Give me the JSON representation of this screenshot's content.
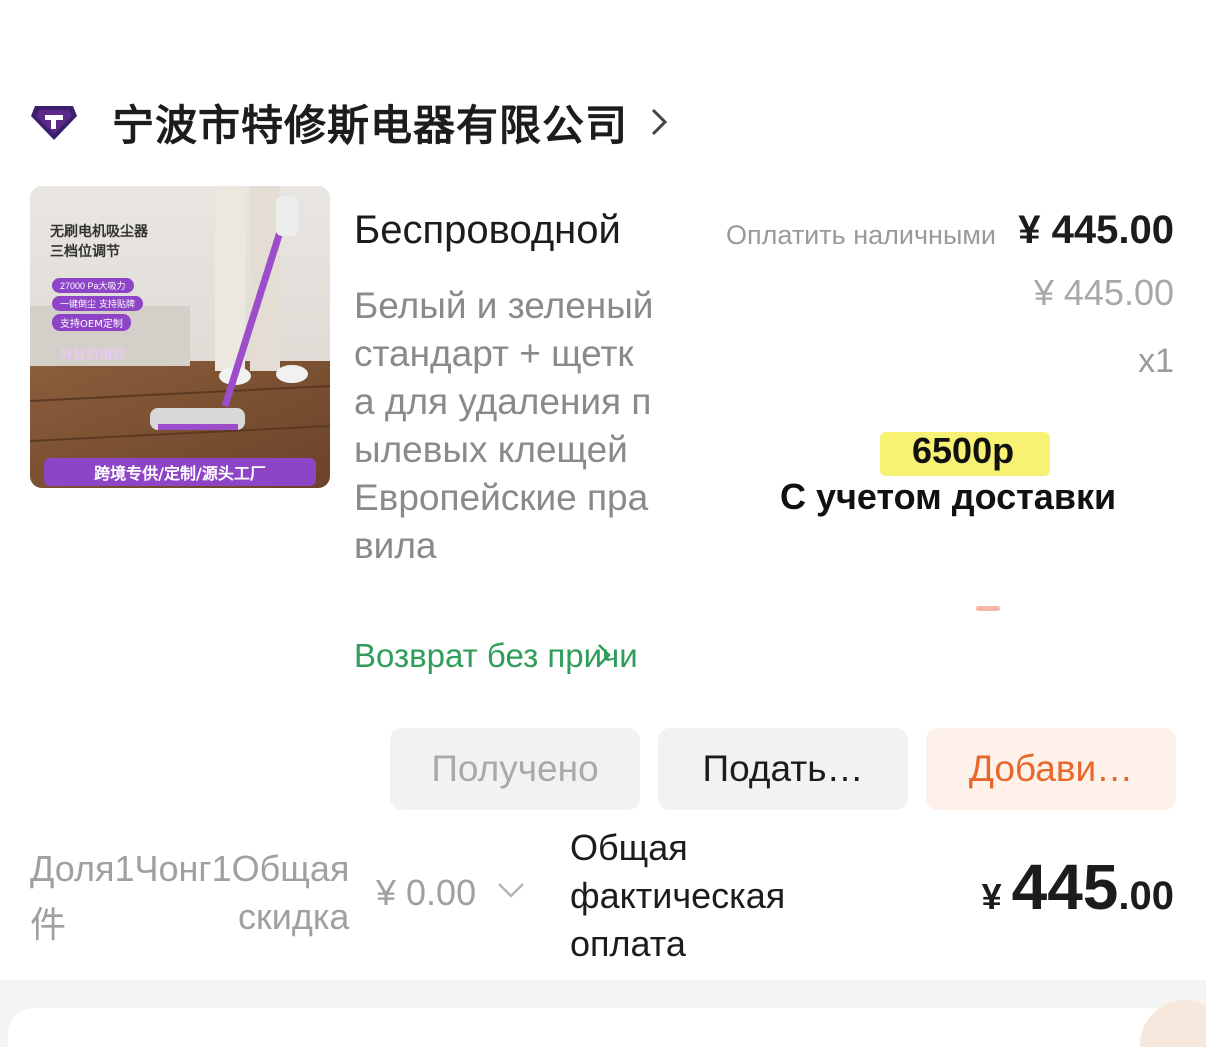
{
  "shop": {
    "name": "宁波市特修斯电器有限公司",
    "logo_icon": "shop-logo-icon",
    "chevron_icon": "chevron-right-icon"
  },
  "product": {
    "image_text": {
      "line1": "无刷电机吸尘器",
      "line2": "三档位调节",
      "badge1": "27000 Pa大吸力",
      "badge2": "一键倒尘 支持贴牌",
      "badge3": "支持OEM定制",
      "tag": "外贸热销款",
      "banner": "跨境专供/定制/源头工厂"
    },
    "title": "Беспроводной",
    "variant": "Белый и зеленый стандарт + щетка для удаления пылевых клещей Европейские правила",
    "return_policy": "Возврат без причи"
  },
  "pricing": {
    "pay_label": "Оплатить наличными",
    "price": "¥ 445.00",
    "original_price": "¥ 445.00",
    "quantity": "x1"
  },
  "note": {
    "price": "6500р",
    "delivery": "С учетом доставки",
    "highlight_color": "#f6ef5c"
  },
  "actions": {
    "received": "Получено",
    "submit": "Подать…",
    "add": "Добави…"
  },
  "summary": {
    "labels_line1": "Доля1Чонг1Общая",
    "labels_line2a": "件",
    "labels_line2b": "скидка",
    "discount": "¥ 0.00",
    "total_label": "Общая фактическая оплата",
    "total_symbol": "¥",
    "total_integer": "445",
    "total_decimal": ".00"
  },
  "colors": {
    "accent_orange": "#e8682c",
    "green_text": "#2f9e5a",
    "logo_purple": "#5b2a86"
  }
}
